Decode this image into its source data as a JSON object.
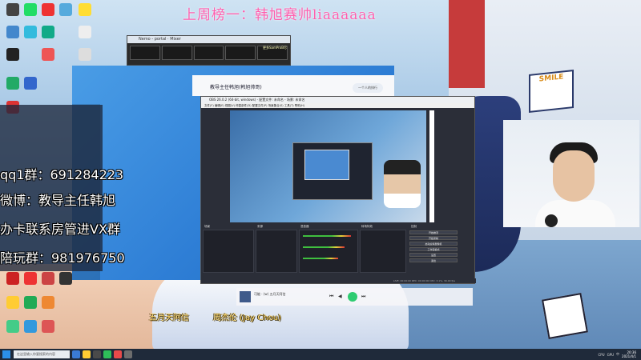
{
  "overlay": {
    "headline": "上周榜一：韩旭赛帅liaaaaaa",
    "qq_group": "qq1群：691284223",
    "weibo": "微博：教导主任韩旭",
    "card_line": "办卡联系房管进VX群",
    "play_group": "陪玩群：981976750"
  },
  "lyrics": {
    "left": "五月天阿信",
    "right": "周杰伦 (Jay Chou)"
  },
  "mixer": {
    "title": "Nemo - portal · Mixer",
    "link": "更多SamProB尽"
  },
  "chat": {
    "contact_name": "教导主任韩旭(韩旭帅哥)",
    "pill_label": "一个人的排行"
  },
  "obs": {
    "title": "OBS 26.0.2 (64-bit, windows) - 配置文件: 未命名 - 场景: 未命名",
    "menu": "文件(F)  编辑(E)  视图(V)  停靠部件(D)  配置文件(P)  场景集合(S)  工具(T)  帮助(H)",
    "dock_scenes": "场景",
    "dock_sources": "来源",
    "dock_mixer": "混音器",
    "dock_transitions": "转场特效",
    "dock_controls": "控制",
    "controls": [
      "开始推流",
      "开始录制",
      "启动虚拟摄像机",
      "工作室模式",
      "设置",
      "退出"
    ],
    "status": "LIVE: 00:00:00  REC: 00:00:00  CPU: 3.1%, 30.00 fps"
  },
  "player": {
    "title": "可能 · (w) 五月天阿信"
  },
  "store": {
    "sign": "SMILE"
  },
  "taskbar": {
    "search": "在这里输入你要搜索的内容",
    "tray": [
      "CPU",
      "GPU",
      "中"
    ],
    "time": "20:36",
    "date": "2021/4/1"
  }
}
